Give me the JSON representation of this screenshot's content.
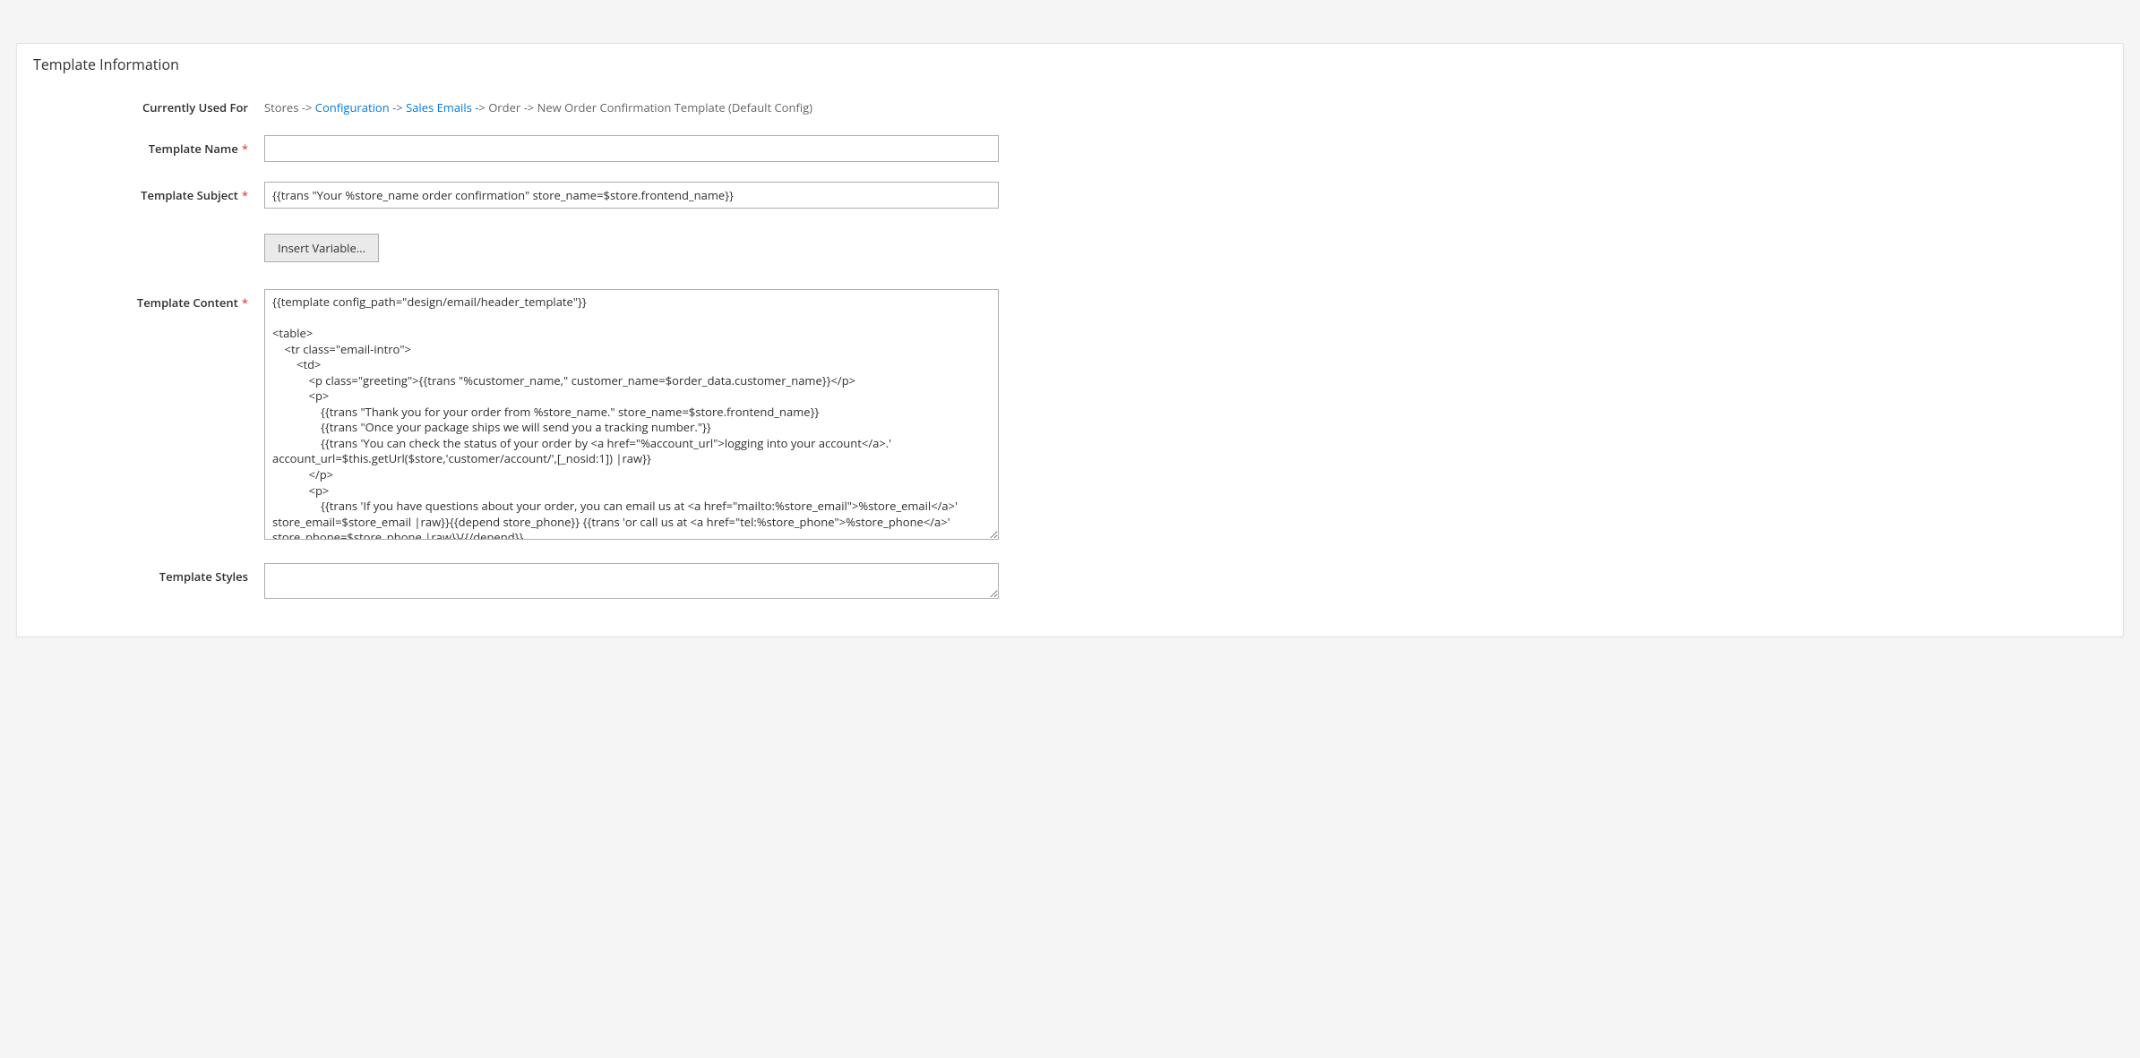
{
  "panel": {
    "title": "Template Information"
  },
  "labels": {
    "currently_used_for": "Currently Used For",
    "template_name": "Template Name",
    "template_subject": "Template Subject",
    "template_content": "Template Content",
    "template_styles": "Template Styles"
  },
  "breadcrumb": {
    "stores": "Stores",
    "sep": " -> ",
    "configuration": "Configuration",
    "sales_emails": "Sales Emails",
    "order": "Order",
    "tail": "New Order Confirmation Template  (Default Config)"
  },
  "values": {
    "template_name": "",
    "template_subject": "{{trans \"Your %store_name order confirmation\" store_name=$store.frontend_name}}",
    "template_content": "{{template config_path=\"design/email/header_template\"}}\n\n<table>\n    <tr class=\"email-intro\">\n        <td>\n            <p class=\"greeting\">{{trans \"%customer_name,\" customer_name=$order_data.customer_name}}</p>\n            <p>\n                {{trans \"Thank you for your order from %store_name.\" store_name=$store.frontend_name}}\n                {{trans \"Once your package ships we will send you a tracking number.\"}}\n                {{trans 'You can check the status of your order by <a href=\"%account_url\">logging into your account</a>.' account_url=$this.getUrl($store,'customer/account/',[_nosid:1]) |raw}}\n            </p>\n            <p>\n                {{trans 'If you have questions about your order, you can email us at <a href=\"mailto:%store_email\">%store_email</a>' store_email=$store_email |raw}}{{depend store_phone}} {{trans 'or call us at <a href=\"tel:%store_phone\">%store_phone</a>' store_phone=$store_phone |raw}}{{/depend}}.\n                {{depend store_hours}}\n                    {{trans 'Our hours are <span class=\"no-link\">%store_hours</span>.' store_hours=$store_hours |raw}}\n                {{/depend}}\n            </p>",
    "template_styles": ""
  },
  "buttons": {
    "insert_variable": "Insert Variable..."
  }
}
